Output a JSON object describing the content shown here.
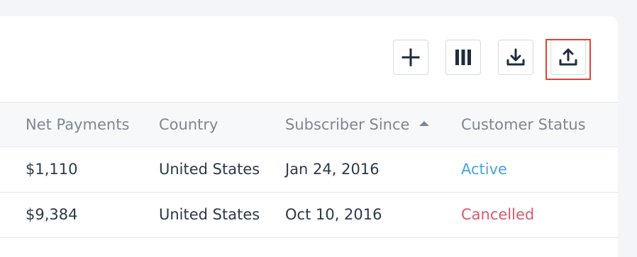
{
  "toolbar": {
    "buttons": [
      {
        "icon": "plus-icon"
      },
      {
        "icon": "columns-icon"
      },
      {
        "icon": "download-icon"
      },
      {
        "icon": "upload-icon"
      }
    ]
  },
  "table": {
    "columns": [
      "Net Payments",
      "Country",
      "Subscriber Since",
      "Customer Status"
    ],
    "sorted_column": "Subscriber Since",
    "sort_direction": "ascending",
    "rows": [
      {
        "net_payments": "$1,110",
        "country": "United States",
        "subscriber_since": "Jan 24, 2016",
        "status": "Active"
      },
      {
        "net_payments": "$9,384",
        "country": "United States",
        "subscriber_since": "Oct 10, 2016",
        "status": "Cancelled"
      }
    ]
  },
  "colors": {
    "active": "#4aa3df",
    "cancelled": "#e0566e",
    "highlight": "#e0432f",
    "text": "#2b3a4a",
    "header_text": "#7d8792"
  }
}
